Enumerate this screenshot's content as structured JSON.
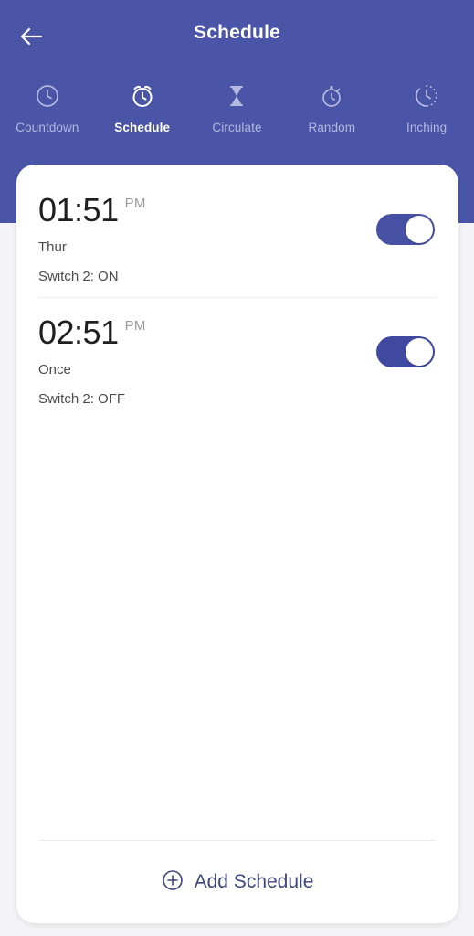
{
  "header": {
    "title": "Schedule",
    "back_icon": "arrow-left-icon",
    "bg_color": "#4b55a8"
  },
  "tabs": [
    {
      "label": "Countdown",
      "icon": "clock-icon",
      "active": false
    },
    {
      "label": "Schedule",
      "icon": "alarm-clock-icon",
      "active": true
    },
    {
      "label": "Circulate",
      "icon": "hourglass-icon",
      "active": false
    },
    {
      "label": "Random",
      "icon": "stopwatch-icon",
      "active": false
    },
    {
      "label": "Inching",
      "icon": "timer-dotted-icon",
      "active": false
    }
  ],
  "schedules": [
    {
      "time": "01:51",
      "meridiem": "PM",
      "repeat": "Thur",
      "action": "Switch 2: ON",
      "enabled": true,
      "toggle_color": "#4751a3"
    },
    {
      "time": "02:51",
      "meridiem": "PM",
      "repeat": "Once",
      "action": "Switch 2: OFF",
      "enabled": true,
      "toggle_color": "#3f49a0"
    }
  ],
  "footer": {
    "add_label": "Add Schedule",
    "add_icon": "plus-circle-icon",
    "add_color": "#3d4680"
  }
}
